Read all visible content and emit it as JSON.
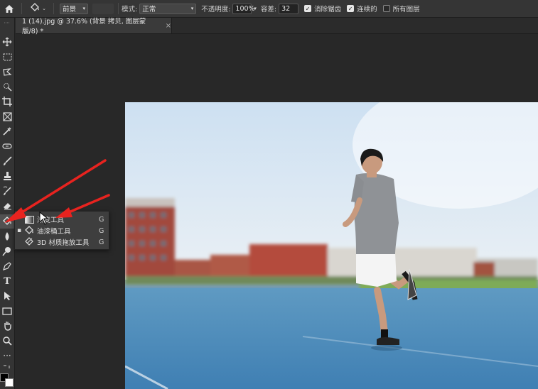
{
  "options_bar": {
    "home_icon": "home-icon",
    "tool_preset_icon": "paint-bucket-icon",
    "fill_source": "前景",
    "mode_label": "模式:",
    "mode_value": "正常",
    "opacity_label": "不透明度:",
    "opacity_value": "100%",
    "tolerance_label": "容差:",
    "tolerance_value": "32",
    "anti_alias_label": "消除锯齿",
    "anti_alias_checked": true,
    "contiguous_label": "连续的",
    "contiguous_checked": true,
    "all_layers_label": "所有图层",
    "all_layers_checked": false
  },
  "document_tab": {
    "title": "1 (14).jpg @ 37.6% (背景 拷贝, 图层蒙版/8) *",
    "close": "×"
  },
  "flyout": {
    "items": [
      {
        "label": "渐变工具",
        "shortcut": "G",
        "icon": "gradient-icon",
        "selected": false
      },
      {
        "label": "油漆桶工具",
        "shortcut": "G",
        "icon": "paint-bucket-icon",
        "selected": true
      },
      {
        "label": "3D 材质拖放工具",
        "shortcut": "G",
        "icon": "3d-material-drop-icon",
        "selected": false
      }
    ]
  },
  "colors": {
    "annotation_arrow": "#e8231f",
    "ui_background": "#282828",
    "panel": "#353535"
  }
}
